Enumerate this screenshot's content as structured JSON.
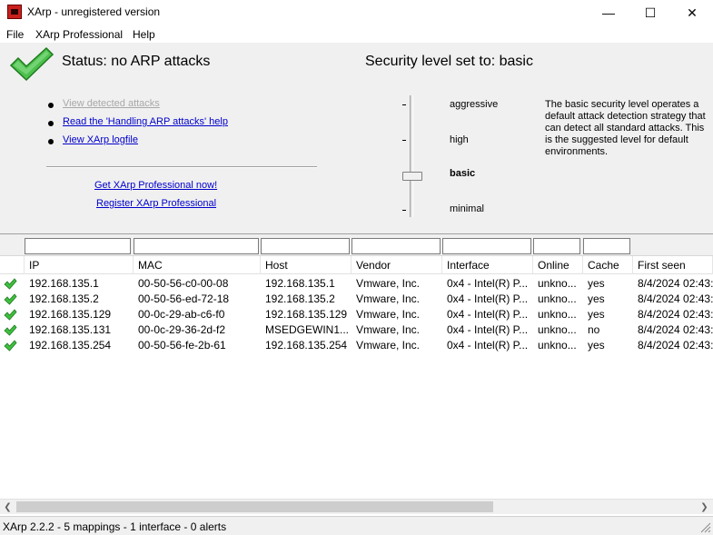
{
  "window": {
    "title": "XArp - unregistered version",
    "minimize_glyph": "—",
    "maximize_glyph": "☐",
    "close_glyph": "✕"
  },
  "menu": {
    "file": "File",
    "pro": "XArp Professional",
    "help": "Help"
  },
  "status": {
    "text": "Status:  no ARP attacks",
    "icon": "check-icon",
    "icon_color": "#2ea02e"
  },
  "security": {
    "label": "Security level set to:  basic",
    "levels": [
      "aggressive",
      "high",
      "basic",
      "minimal"
    ],
    "selected": "basic",
    "description": "The basic security level operates a default attack detection strategy that can detect all standard attacks. This is the suggested level for default environments."
  },
  "links": {
    "view_attacks": "View detected attacks",
    "handling_help": "Read the 'Handling ARP attacks' help",
    "logfile": "View XArp logfile",
    "get_pro": "Get XArp Professional now!",
    "register": "Register XArp Professional"
  },
  "table": {
    "columns": [
      "IP",
      "MAC",
      "Host",
      "Vendor",
      "Interface",
      "Online",
      "Cache",
      "First seen"
    ],
    "rows": [
      [
        "192.168.135.1",
        "00-50-56-c0-00-08",
        "192.168.135.1",
        "Vmware, Inc.",
        "0x4 - Intel(R) P...",
        "unkno...",
        "yes",
        "8/4/2024 02:43:"
      ],
      [
        "192.168.135.2",
        "00-50-56-ed-72-18",
        "192.168.135.2",
        "Vmware, Inc.",
        "0x4 - Intel(R) P...",
        "unkno...",
        "yes",
        "8/4/2024 02:43:"
      ],
      [
        "192.168.135.129",
        "00-0c-29-ab-c6-f0",
        "192.168.135.129",
        "Vmware, Inc.",
        "0x4 - Intel(R) P...",
        "unkno...",
        "yes",
        "8/4/2024 02:43:"
      ],
      [
        "192.168.135.131",
        "00-0c-29-36-2d-f2",
        "MSEDGEWIN1...",
        "Vmware, Inc.",
        "0x4 - Intel(R) P...",
        "unkno...",
        "no",
        "8/4/2024 02:43:"
      ],
      [
        "192.168.135.254",
        "00-50-56-fe-2b-61",
        "192.168.135.254",
        "Vmware, Inc.",
        "0x4 - Intel(R) P...",
        "unkno...",
        "yes",
        "8/4/2024 02:43:"
      ]
    ]
  },
  "scrollbar": {
    "left_arrow": "❮",
    "right_arrow": "❯"
  },
  "statusbar": {
    "text": "XArp 2.2.2  -  5 mappings  -  1 interface  -  0 alerts"
  }
}
